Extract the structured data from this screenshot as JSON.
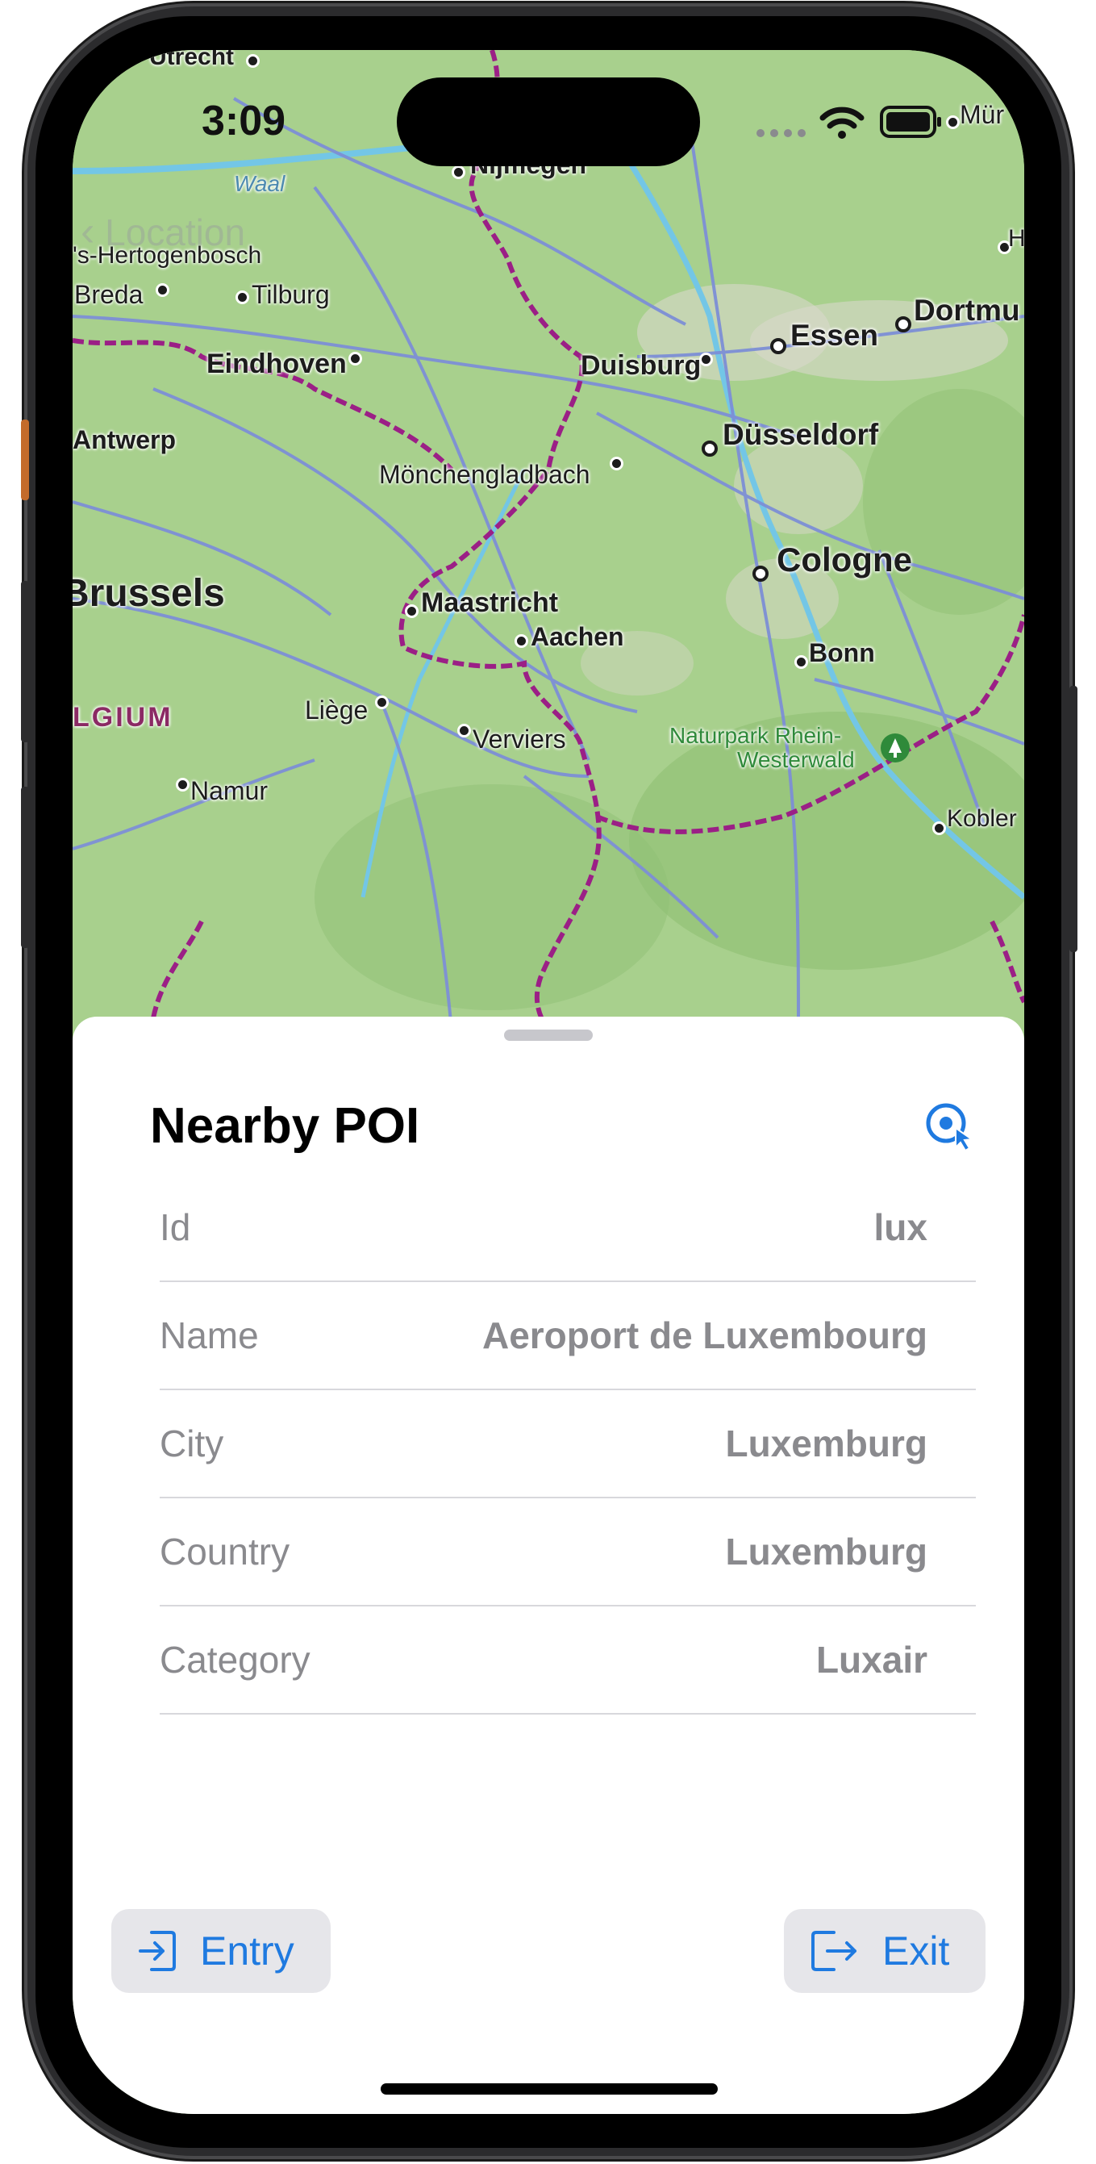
{
  "status_bar": {
    "time": "3:09"
  },
  "nav": {
    "back_label": "Location"
  },
  "map": {
    "labels": [
      {
        "text": "Utrecht"
      },
      {
        "text": "Nijmegen"
      },
      {
        "text": "Waal"
      },
      {
        "text": "'s-Hertogenbosch"
      },
      {
        "text": "Breda"
      },
      {
        "text": "Tilburg"
      },
      {
        "text": "Eindhoven"
      },
      {
        "text": "Antwerp"
      },
      {
        "text": "Duisburg"
      },
      {
        "text": "Essen"
      },
      {
        "text": "Dortmu"
      },
      {
        "text": "Düsseldorf"
      },
      {
        "text": "Mönchengladbach"
      },
      {
        "text": "Cologne"
      },
      {
        "text": "Brussels"
      },
      {
        "text": "Maastricht"
      },
      {
        "text": "Aachen"
      },
      {
        "text": "Bonn"
      },
      {
        "text": "LGIUM"
      },
      {
        "text": "Liège"
      },
      {
        "text": "Verviers"
      },
      {
        "text": "Naturpark Rhein-"
      },
      {
        "text": "Westerwald"
      },
      {
        "text": "Namur"
      },
      {
        "text": "Kobler"
      },
      {
        "text": "Mür"
      },
      {
        "text": "H"
      }
    ]
  },
  "sheet": {
    "title": "Nearby POI",
    "locate_icon": "location-tap-icon",
    "rows": [
      {
        "label": "Id",
        "value": "lux"
      },
      {
        "label": "Name",
        "value": "Aeroport de Luxembourg"
      },
      {
        "label": "City",
        "value": "Luxemburg"
      },
      {
        "label": "Country",
        "value": "Luxemburg"
      },
      {
        "label": "Category",
        "value": "Luxair"
      }
    ],
    "entry_button": "Entry",
    "exit_button": "Exit"
  },
  "colors": {
    "accent": "#1f7ae0",
    "map_green": "#a8d08d",
    "border_purple": "#9b1f86",
    "road_blue": "#7d8fd6",
    "river": "#73c6e6"
  }
}
